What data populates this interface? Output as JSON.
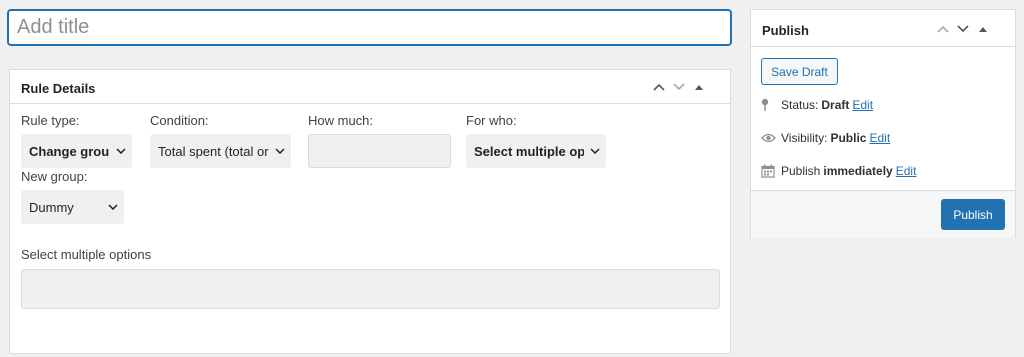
{
  "title_input": {
    "placeholder": "Add title",
    "value": ""
  },
  "rule_box": {
    "title": "Rule Details",
    "fields": {
      "rule_type": {
        "label": "Rule type:",
        "value": "Change group"
      },
      "condition": {
        "label": "Condition:",
        "value": "Total spent (total or"
      },
      "how_much": {
        "label": "How much:",
        "value": ""
      },
      "for_who": {
        "label": "For who:",
        "value": "Select multiple opti"
      },
      "new_group": {
        "label": "New group:",
        "value": "Dummy"
      }
    },
    "multi_select": {
      "label": "Select multiple options",
      "value": ""
    }
  },
  "publish_box": {
    "title": "Publish",
    "save_draft_label": "Save Draft",
    "status": {
      "label": "Status:",
      "value": "Draft",
      "edit": "Edit"
    },
    "visibility": {
      "label": "Visibility:",
      "value": "Public",
      "edit": "Edit"
    },
    "publish_time": {
      "label": "Publish",
      "value": "immediately",
      "edit": "Edit"
    },
    "publish_label": "Publish"
  },
  "colors": {
    "accent": "#2271b1",
    "background": "#f0f0f1",
    "border": "#dcdcde"
  },
  "icons": [
    "chevron-up-icon",
    "chevron-down-icon",
    "triangle-up-icon",
    "pin-icon",
    "eye-icon",
    "calendar-icon",
    "select-chevron-icon"
  ]
}
